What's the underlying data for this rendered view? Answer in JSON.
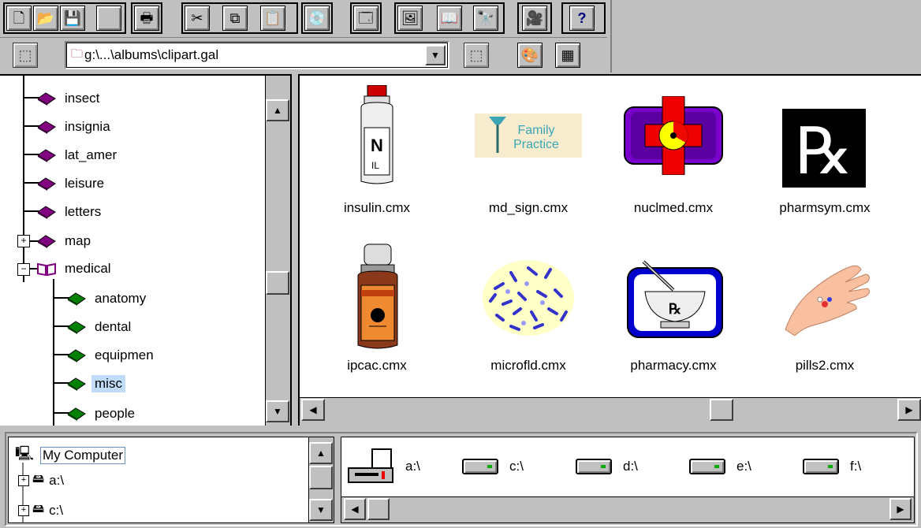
{
  "toolbar": {
    "buttons": [
      {
        "name": "new-icon",
        "glyph": "🗋"
      },
      {
        "name": "open-folder-icon",
        "glyph": "📂"
      },
      {
        "name": "save-icon",
        "glyph": "💾"
      },
      {
        "name": "print-icon",
        "glyph": "🖶"
      },
      {
        "name": "cut-icon",
        "glyph": "✂"
      },
      {
        "name": "copy-icon",
        "glyph": "⧉"
      },
      {
        "name": "paste-icon",
        "glyph": "📋"
      },
      {
        "name": "cd-icon",
        "glyph": "💿"
      },
      {
        "name": "properties-icon",
        "glyph": "🗔"
      },
      {
        "name": "gallery-icon",
        "glyph": "🖼"
      },
      {
        "name": "book-icon",
        "glyph": "📖"
      },
      {
        "name": "find-icon",
        "glyph": "🔭"
      },
      {
        "name": "movie-icon",
        "glyph": "🎥"
      },
      {
        "name": "help-icon",
        "glyph": "?"
      }
    ]
  },
  "address": {
    "value": "g:\\...\\albums\\clipart.gal"
  },
  "tree": {
    "items": [
      {
        "label": "insect",
        "level": 0,
        "expander": ""
      },
      {
        "label": "insignia",
        "level": 0,
        "expander": ""
      },
      {
        "label": "lat_amer",
        "level": 0,
        "expander": ""
      },
      {
        "label": "leisure",
        "level": 0,
        "expander": ""
      },
      {
        "label": "letters",
        "level": 0,
        "expander": ""
      },
      {
        "label": "map",
        "level": 0,
        "expander": "+"
      },
      {
        "label": "medical",
        "level": 0,
        "expander": "−"
      },
      {
        "label": "anatomy",
        "level": 1,
        "expander": ""
      },
      {
        "label": "dental",
        "level": 1,
        "expander": ""
      },
      {
        "label": "equipmen",
        "level": 1,
        "expander": ""
      },
      {
        "label": "misc",
        "level": 1,
        "expander": "",
        "selected": true
      },
      {
        "label": "people",
        "level": 1,
        "expander": ""
      }
    ]
  },
  "thumbnails": [
    {
      "file": "insulin.cmx"
    },
    {
      "file": "md_sign.cmx",
      "sign_text_1": "Family",
      "sign_text_2": "Practice"
    },
    {
      "file": "nuclmed.cmx"
    },
    {
      "file": "pharmsym.cmx",
      "symbol": "℞"
    },
    {
      "file": "ipcac.cmx"
    },
    {
      "file": "microfld.cmx"
    },
    {
      "file": "pharmacy.cmx",
      "symbol": "℞"
    },
    {
      "file": "pills2.cmx"
    }
  ],
  "computer_tree": {
    "root": "My Computer",
    "items": [
      "a:\\",
      "c:\\"
    ]
  },
  "drives": [
    "a:\\",
    "c:\\",
    "d:\\",
    "e:\\",
    "f:\\"
  ],
  "colors": {
    "face": "#c0c0c0",
    "book_purple": "#800080",
    "book_green": "#008000",
    "selection": "#c0dcf8"
  }
}
